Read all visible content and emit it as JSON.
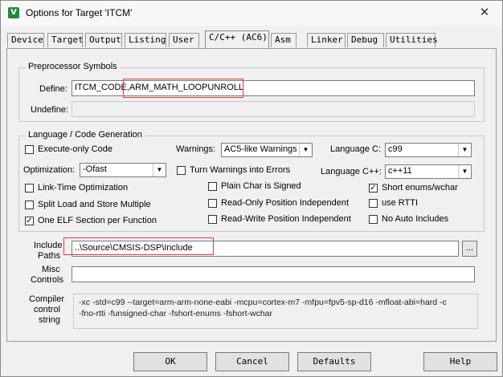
{
  "window": {
    "title": "Options for Target 'ITCM'",
    "icon_name": "keil-app-icon",
    "close_glyph": "✕"
  },
  "tabs": [
    {
      "label": "Device"
    },
    {
      "label": "Target"
    },
    {
      "label": "Output"
    },
    {
      "label": "Listing"
    },
    {
      "label": "User"
    },
    {
      "label": "C/C++ (AC6)"
    },
    {
      "label": "Asm"
    },
    {
      "label": "Linker"
    },
    {
      "label": "Debug"
    },
    {
      "label": "Utilities"
    }
  ],
  "active_tab": "C/C++ (AC6)",
  "preprocessor": {
    "group_title": "Preprocessor Symbols",
    "define_label": "Define:",
    "define_value": "ITCM_CODE,ARM_MATH_LOOPUNROLL",
    "undefine_label": "Undefine:",
    "undefine_value": ""
  },
  "language": {
    "group_title": "Language / Code Generation",
    "execute_only": {
      "label": "Execute-only Code",
      "checked": false
    },
    "warnings_label": "Warnings:",
    "warnings_value": "AC5-like Warnings",
    "language_c_label": "Language C:",
    "language_c_value": "c99",
    "optimization_label": "Optimization:",
    "optimization_value": "-Ofast",
    "turn_warnings": {
      "label": "Turn Warnings into Errors",
      "checked": false
    },
    "language_cpp_label": "Language C++:",
    "language_cpp_value": "c++11",
    "link_time": {
      "label": "Link-Time Optimization",
      "checked": false
    },
    "plain_char": {
      "label": "Plain Char is Signed",
      "checked": false
    },
    "short_enums": {
      "label": "Short enums/wchar",
      "checked": true
    },
    "split_load": {
      "label": "Split Load and Store Multiple",
      "checked": false
    },
    "ropi": {
      "label": "Read-Only Position Independent",
      "checked": false
    },
    "use_rtti": {
      "label": "use RTTI",
      "checked": false
    },
    "one_elf": {
      "label": "One ELF Section per Function",
      "checked": true
    },
    "rwpi": {
      "label": "Read-Write Position Independent",
      "checked": false
    },
    "no_auto_includes": {
      "label": "No Auto Includes",
      "checked": false
    },
    "check_glyph": "✓"
  },
  "include": {
    "label_line1": "Include",
    "label_line2": "Paths",
    "value": "..\\Source\\CMSIS-DSP\\Include",
    "browse_label": "..."
  },
  "misc": {
    "label_line1": "Misc",
    "label_line2": "Controls",
    "value": ""
  },
  "compiler": {
    "label_line1": "Compiler",
    "label_line2": "control",
    "label_line3": "string",
    "line1": "-xc -std=c99 --target=arm-arm-none-eabi -mcpu=cortex-m7 -mfpu=fpv5-sp-d16 -mfloat-abi=hard -c",
    "line2": "-fno-rtti -funsigned-char -fshort-enums -fshort-wchar"
  },
  "buttons": {
    "ok": "OK",
    "cancel": "Cancel",
    "defaults": "Defaults",
    "help": "Help"
  },
  "dropdown_glyph": "▼",
  "colors": {
    "highlight": "#e23b3b",
    "app_icon": "#1f8a3b"
  }
}
